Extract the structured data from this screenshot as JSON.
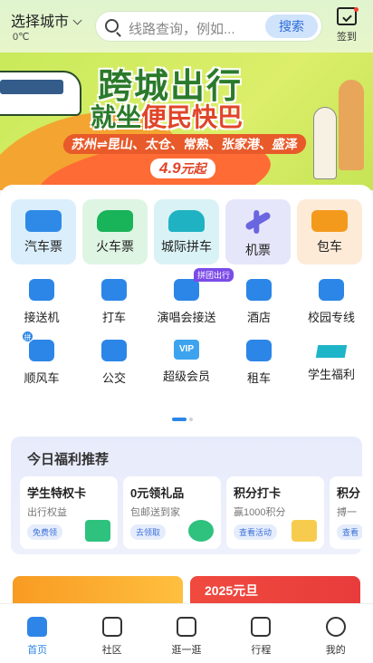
{
  "header": {
    "city": "选择城市",
    "temperature": "0℃",
    "search_placeholder": "线路查询，例如...",
    "search_button": "搜索",
    "signin_label": "签到"
  },
  "banner": {
    "title_line1": "跨城出行",
    "title_line2_prefix": "就坐",
    "title_line2_highlight": "便民快巴",
    "route": "苏州⇌昆山、太仓、常熟、张家港、盛泽",
    "price_value": "4.9",
    "price_suffix": "元起"
  },
  "main_cards": [
    {
      "label": "汽车票",
      "icon": "bus-icon"
    },
    {
      "label": "火车票",
      "icon": "train-icon"
    },
    {
      "label": "城际拼车",
      "icon": "car-icon"
    },
    {
      "label": "机票",
      "icon": "plane-icon"
    },
    {
      "label": "包车",
      "icon": "charter-bus-icon"
    }
  ],
  "services": [
    {
      "label": "接送机",
      "icon": "airport-shuttle-icon"
    },
    {
      "label": "打车",
      "icon": "taxi-icon"
    },
    {
      "label": "演唱会接送",
      "icon": "concert-shuttle-icon",
      "tag": "拼团出行"
    },
    {
      "label": "酒店",
      "icon": "hotel-icon"
    },
    {
      "label": "校园专线",
      "icon": "campus-bus-icon"
    },
    {
      "label": "顺风车",
      "icon": "carpool-icon",
      "tag": "拼"
    },
    {
      "label": "公交",
      "icon": "bus-icon"
    },
    {
      "label": "超级会员",
      "icon": "vip-icon",
      "badge_text": "VIP"
    },
    {
      "label": "租车",
      "icon": "car-rental-icon"
    },
    {
      "label": "学生福利",
      "icon": "graduation-cap-icon"
    }
  ],
  "welfare": {
    "title": "今日福利推荐",
    "cards": [
      {
        "title": "学生特权卡",
        "subtitle": "出行权益",
        "button": "免费领"
      },
      {
        "title": "0元领礼品",
        "subtitle": "包邮送到家",
        "button": "去领取"
      },
      {
        "title": "积分打卡",
        "subtitle": "赢1000积分",
        "button": "查看活动"
      },
      {
        "title": "积分",
        "subtitle": "搏一",
        "button": "查看"
      }
    ]
  },
  "promos": {
    "right_text": "2025元旦"
  },
  "tabbar": [
    {
      "label": "首页",
      "icon": "home-icon",
      "active": true
    },
    {
      "label": "社区",
      "icon": "community-icon",
      "active": false
    },
    {
      "label": "逛一逛",
      "icon": "gift-icon",
      "active": false
    },
    {
      "label": "行程",
      "icon": "itinerary-icon",
      "active": false
    },
    {
      "label": "我的",
      "icon": "profile-icon",
      "active": false
    }
  ],
  "colors": {
    "accent": "#2e85e8",
    "banner_green": "#c9ea5a",
    "title_green": "#2b7a2b",
    "highlight_red": "#e0452a"
  }
}
